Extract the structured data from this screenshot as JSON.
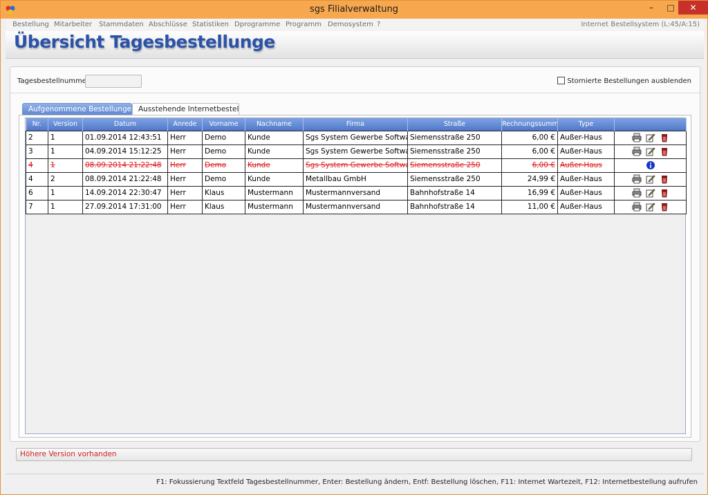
{
  "window": {
    "title": "sgs Filialverwaltung"
  },
  "menu": {
    "items": [
      "Bestellung",
      "Mitarbeiter",
      "Stammdaten",
      "Abschlüsse",
      "Statistiken",
      "Dprogramme",
      "Programm",
      "Demosystem",
      "?"
    ],
    "right_text": "Internet Bestellsystem (L:45/A:15)"
  },
  "header": {
    "title": "Übersicht Tagesbestellunge"
  },
  "filter": {
    "label": "Tagesbestellnummer:",
    "value": "",
    "checkbox_label": "Stornierte Bestellungen ausblenden"
  },
  "tabs": [
    {
      "label": "Aufgenommene Bestellungen",
      "active": true
    },
    {
      "label": "Ausstehende Internetbestellung",
      "active": false
    }
  ],
  "table": {
    "columns": [
      "Nr.",
      "Version",
      "Datum",
      "Anrede",
      "Vorname",
      "Nachname",
      "Firma",
      "Straße",
      "Rechnungssumme",
      "Type",
      ""
    ],
    "rows": [
      {
        "cells": [
          "2",
          "1",
          "01.09.2014 12:43:51",
          "Herr",
          "Demo",
          "Kunde",
          "Sgs System Gewerbe Software",
          "Siemensstraße 250",
          "6,00 €",
          "Außer-Haus"
        ],
        "cancelled": false
      },
      {
        "cells": [
          "3",
          "1",
          "04.09.2014 15:12:25",
          "Herr",
          "Demo",
          "Kunde",
          "Sgs System Gewerbe Software",
          "Siemensstraße 250",
          "6,00 €",
          "Außer-Haus"
        ],
        "cancelled": false
      },
      {
        "cells": [
          "4",
          "1",
          "08.09.2014 21:22:48",
          "Herr",
          "Demo",
          "Kunde",
          "Sgs System Gewerbe Software",
          "Siemensstraße 250",
          "6,00 €",
          "Außer-Haus"
        ],
        "cancelled": true
      },
      {
        "cells": [
          "4",
          "2",
          "08.09.2014 21:22:48",
          "Herr",
          "Demo",
          "Kunde",
          "Metallbau GmbH",
          "Siemensstraße 250",
          "24,99 €",
          "Außer-Haus"
        ],
        "cancelled": false
      },
      {
        "cells": [
          "6",
          "1",
          "14.09.2014 22:30:47",
          "Herr",
          "Klaus",
          "Mustermann",
          "Mustermannversand",
          "Bahnhofstraße 14",
          "16,99 €",
          "Außer-Haus"
        ],
        "cancelled": false
      },
      {
        "cells": [
          "7",
          "1",
          "27.09.2014 17:31:00",
          "Herr",
          "Klaus",
          "Mustermann",
          "Mustermannversand",
          "Bahnhofstraße 14",
          "11,00 €",
          "Außer-Haus"
        ],
        "cancelled": false
      }
    ],
    "actions": [
      "print-icon",
      "edit-icon",
      "delete-icon"
    ],
    "cancelled_action": "info-icon"
  },
  "status": {
    "message": "Höhere Version vorhanden"
  },
  "footer": {
    "hint": "F1: Fokussierung Textfeld Tagesbestellnummer, Enter: Bestellung ändern, Entf: Bestellung löschen, F11: Internet Wartezeit, F12: Internetbestellung aufrufen"
  },
  "colors": {
    "accent": "#2a52a8",
    "title_bar": "#f7a84e",
    "close_button": "#c7312a",
    "cancelled_text": "#e02020",
    "grid_header": "#5c85d1"
  }
}
